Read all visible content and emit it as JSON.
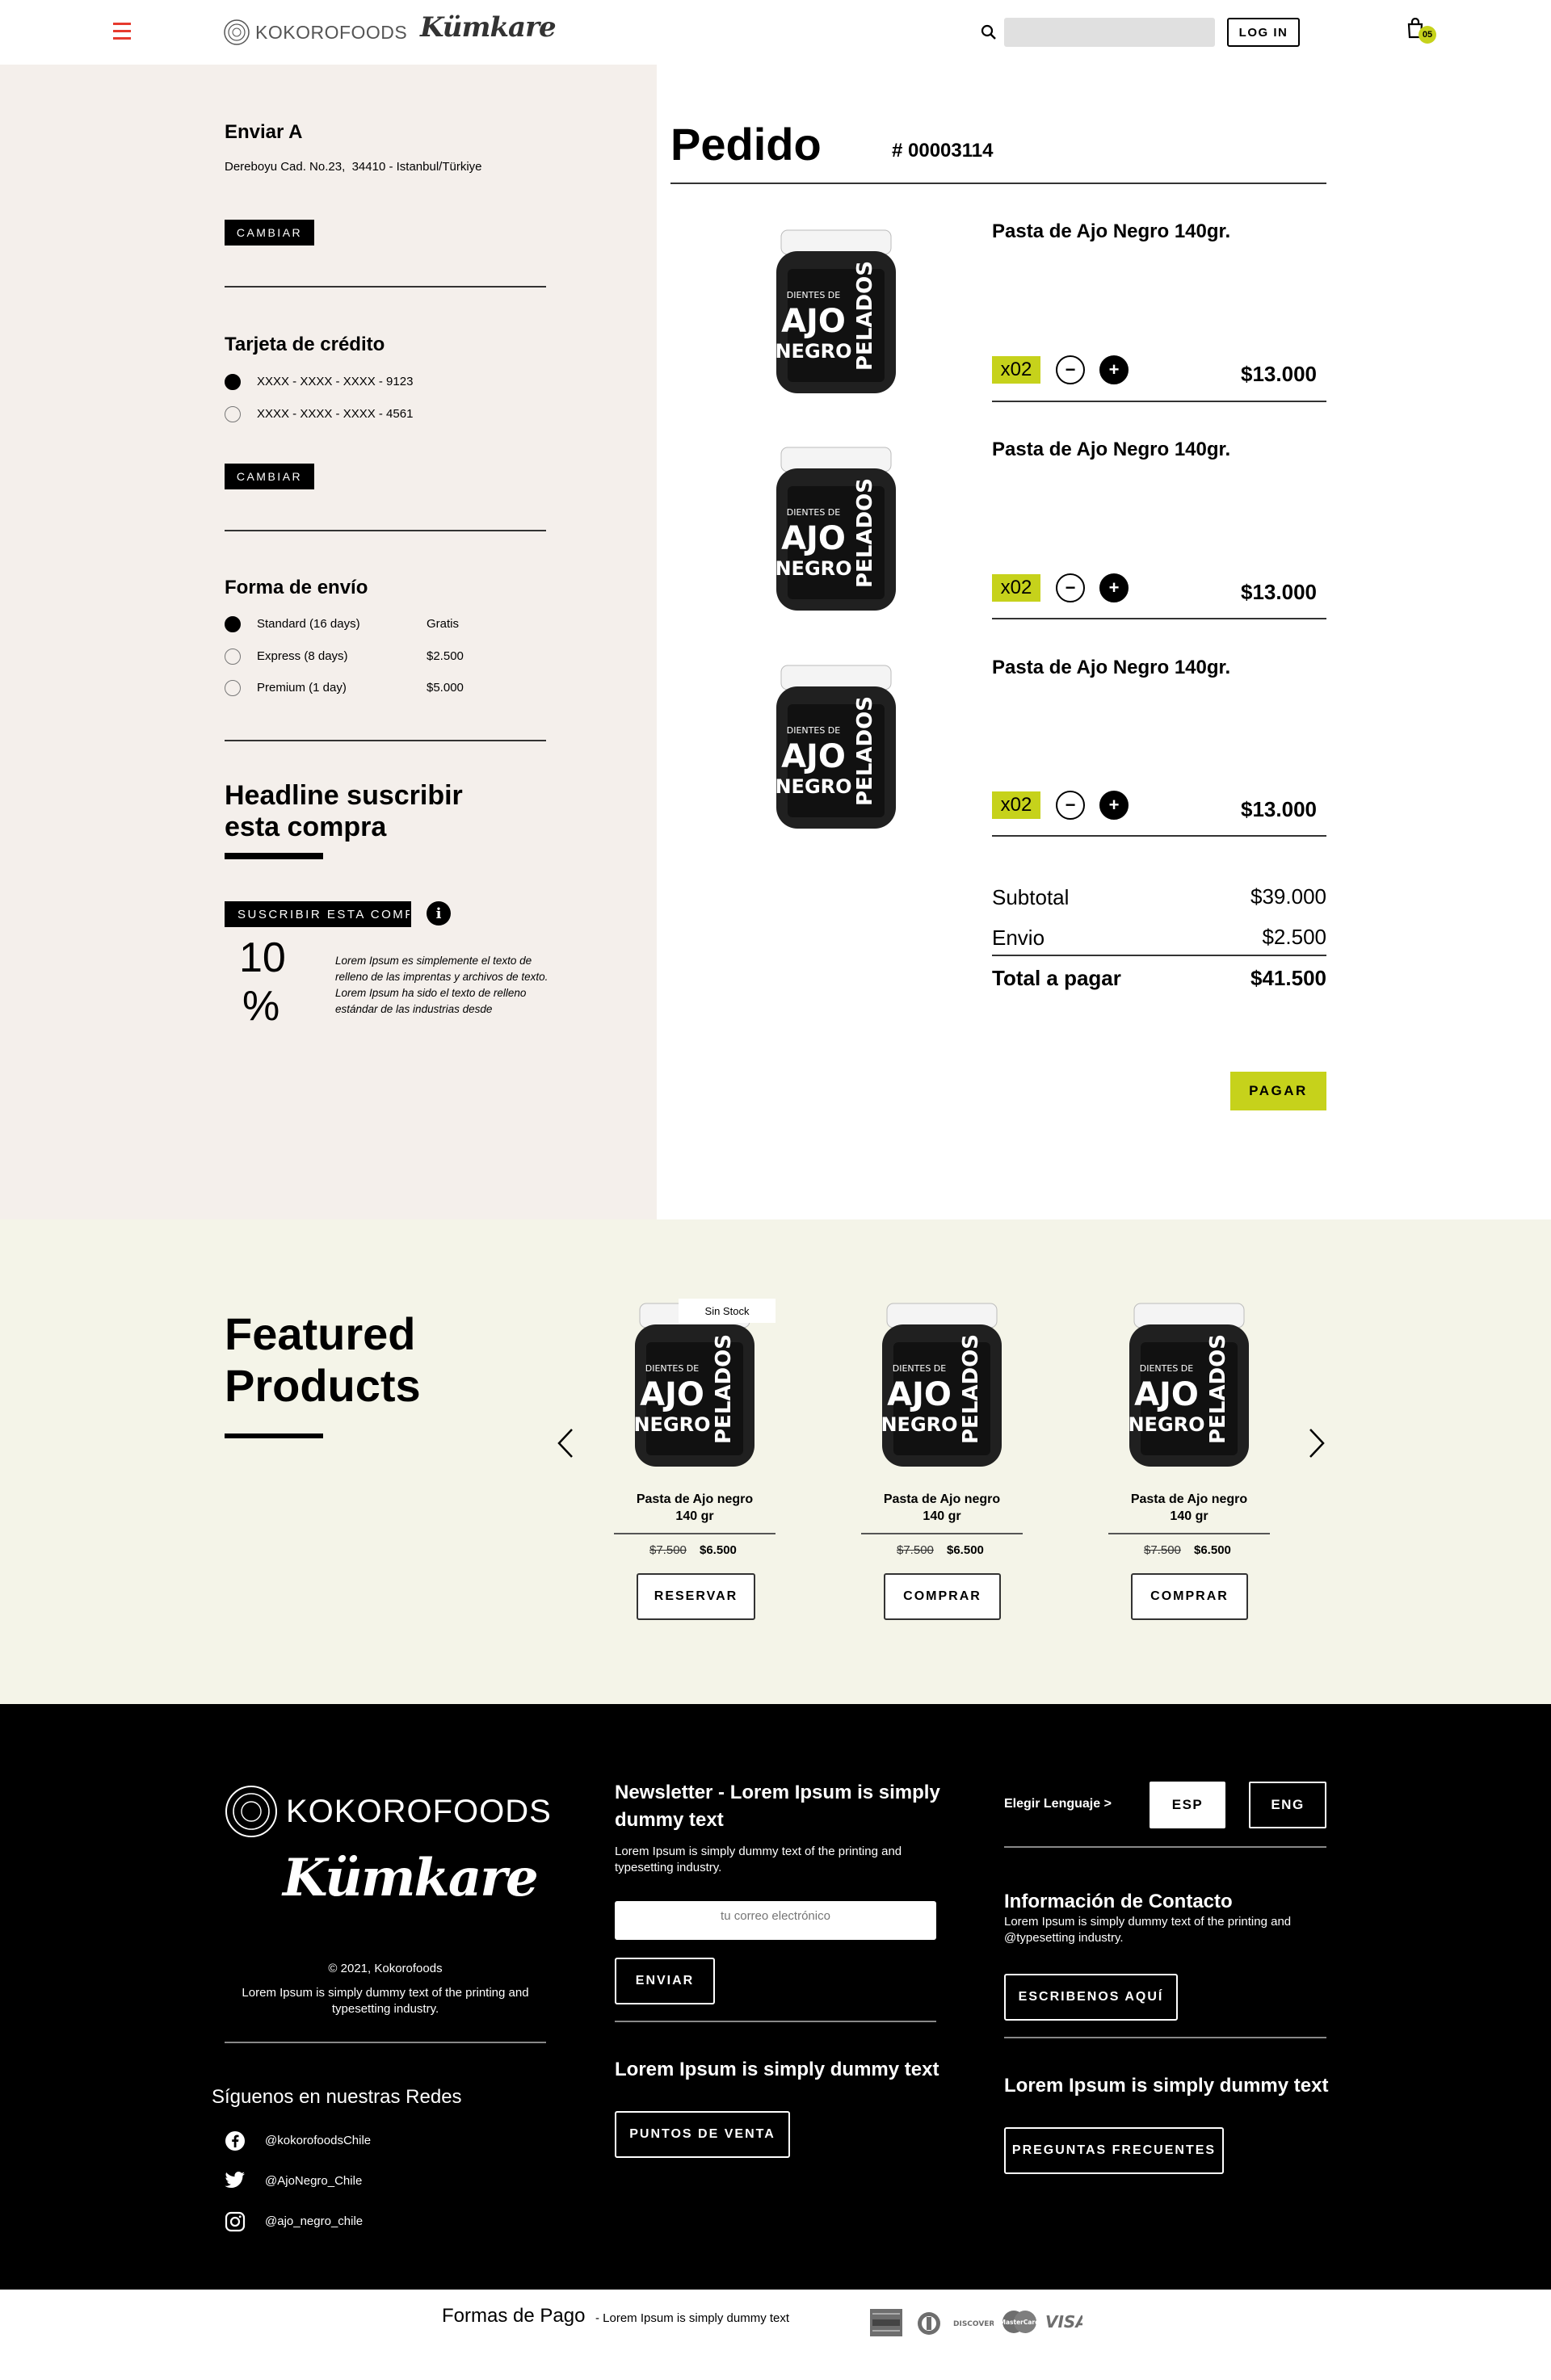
{
  "header": {
    "brand_primary": "KOKOROFOODS",
    "brand_secondary": "Kümkare",
    "search_placeholder": "",
    "login_label": "LOG IN",
    "cart_count": "05",
    "accent_color": "#e63a2e"
  },
  "shipping": {
    "title": "Enviar A",
    "address": "Dereboyu Cad. No.23,  34410 - Istanbul/Türkiye",
    "change_label": "CAMBIAR"
  },
  "card": {
    "title": "Tarjeta de crédito",
    "options": [
      "XXXX - XXXX - XXXX - 9123",
      "XXXX - XXXX - XXXX - 4561"
    ],
    "selected_index": 0,
    "change_label": "CAMBIAR"
  },
  "delivery": {
    "title": "Forma de envío",
    "options": [
      {
        "label": "Standard (16 days)",
        "price": "Gratis"
      },
      {
        "label": "Express (8 days)",
        "price": "$2.500"
      },
      {
        "label": "Premium (1 day)",
        "price": "$5.000"
      }
    ],
    "selected_index": 0
  },
  "subscribe": {
    "headline_line1": "Headline suscribir",
    "headline_line2": "esta compra",
    "button_label": "SUSCRIBIR ESTA COMPRA",
    "info_glyph": "i",
    "discount_value": "10",
    "discount_unit": "%",
    "description": "Lorem Ipsum es simplemente el texto de relleno de las imprentas y archivos de texto. Lorem Ipsum ha sido el texto de relleno estándar de las industrias desde"
  },
  "order": {
    "title": "Pedido",
    "number": "# 00003114",
    "items": [
      {
        "name": "Pasta de Ajo Negro 140gr.",
        "qty": "x02",
        "price": "$13.000"
      },
      {
        "name": "Pasta de Ajo Negro 140gr.",
        "qty": "x02",
        "price": "$13.000"
      },
      {
        "name": "Pasta de Ajo Negro 140gr.",
        "qty": "x02",
        "price": "$13.000"
      }
    ],
    "jar_label": {
      "top": "DIENTES DE",
      "big1": "AJO",
      "big2": "NEGRO",
      "side": "PELADOS"
    },
    "minus_glyph": "−",
    "plus_glyph": "+",
    "subtotal_label": "Subtotal",
    "subtotal_value": "$39.000",
    "shipping_label": "Envio",
    "shipping_value": "$2.500",
    "total_label": "Total a pagar",
    "total_value": "$41.500",
    "pay_label": "PAGAR",
    "pay_color": "#c6d21b"
  },
  "featured": {
    "title_line1": "Featured",
    "title_line2": "Products",
    "prev_glyph": "‹",
    "next_glyph": "›",
    "products": [
      {
        "badge": "Sin Stock",
        "name_line1": "Pasta de Ajo negro",
        "name_line2": "140 gr",
        "old_price": "$7.500",
        "new_price": "$6.500",
        "button": "RESERVAR"
      },
      {
        "badge": "",
        "name_line1": "Pasta de Ajo negro",
        "name_line2": "140 gr",
        "old_price": "$7.500",
        "new_price": "$6.500",
        "button": "COMPRAR"
      },
      {
        "badge": "",
        "name_line1": "Pasta de Ajo negro",
        "name_line2": "140 gr",
        "old_price": "$7.500",
        "new_price": "$6.500",
        "button": "COMPRAR"
      }
    ]
  },
  "footer": {
    "brand_primary": "KOKOROFOODS",
    "brand_secondary": "Kümkare",
    "copyright": "© 2021, Kokorofoods",
    "about": "Lorem Ipsum is simply dummy text of the printing and typesetting industry.",
    "social_title": "Síguenos en nuestras Redes",
    "social": [
      {
        "icon": "facebook-icon",
        "handle": "@kokorofoodsChile"
      },
      {
        "icon": "twitter-icon",
        "handle": "@AjoNegro_Chile"
      },
      {
        "icon": "instagram-icon",
        "handle": "@ajo_negro_chile"
      }
    ],
    "newsletter_title": "Newsletter - Lorem Ipsum is simply dummy text",
    "newsletter_text": "Lorem Ipsum is simply dummy text of the printing and typesetting industry.",
    "email_placeholder": "tu correo electrónico",
    "send_label": "ENVIAR",
    "points_title": "Lorem Ipsum is simply dummy text",
    "points_label": "PUNTOS DE VENTA",
    "language_label": "Elegir Lenguaje >",
    "lang_options": [
      "ESP",
      "ENG"
    ],
    "lang_selected": 0,
    "contact_title": "Información de Contacto",
    "contact_text": "Lorem Ipsum is simply dummy text of the printing and @typesetting industry.",
    "contact_button": "ESCRIBENOS AQUÍ",
    "faq_title": "Lorem Ipsum is simply dummy text",
    "faq_button": "PREGUNTAS FRECUENTES"
  },
  "payment": {
    "title": "Formas de Pago",
    "subtitle": "- Lorem Ipsum is simply dummy text",
    "methods": [
      "amex-icon",
      "diners-icon",
      "discover-icon",
      "mastercard-icon",
      "visa-icon"
    ],
    "discover_text": "DISCOVER",
    "mastercard_text": "MasterCard",
    "visa_text": "VISA"
  }
}
